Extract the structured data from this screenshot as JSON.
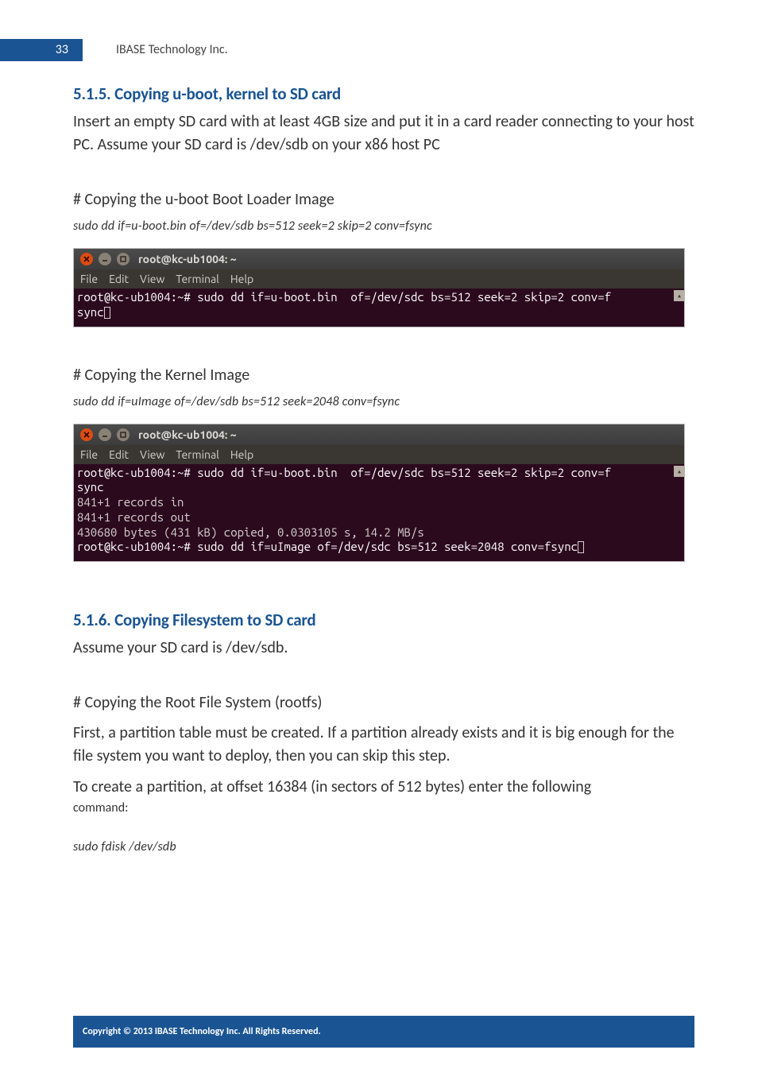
{
  "header": {
    "page_number": "33",
    "company": "IBASE Technology Inc."
  },
  "sec515": {
    "title": "5.1.5. Copying u-boot, kernel to SD card",
    "para": "Insert an empty SD card with at least 4GB size and put it in a card reader connecting to your host PC. Assume your SD card is /dev/sdb on your x86 host PC",
    "sub1": "# Copying the u-boot Boot Loader Image",
    "cmd1": "sudo dd if=u-boot.bin    of=/dev/sdb bs=512 seek=2 skip=2 conv=fsync",
    "sub2": "# Copying the Kernel Image",
    "cmd2": "sudo dd if=uImage of=/dev/sdb bs=512 seek=2048 conv=fsync"
  },
  "term": {
    "title": "root@kc-ub1004: ~",
    "menu": {
      "file": "File",
      "edit": "Edit",
      "view": "View",
      "terminal": "Terminal",
      "help": "Help"
    },
    "t1_line1a": "root@kc-ub1004:~# sudo dd if=u-boot.bin  of=/dev/sdc bs=512 seek=2 skip=2 conv=f",
    "t1_line2": "sync",
    "t2_line1a": "root@kc-ub1004:~# sudo dd if=u-boot.bin  of=/dev/sdc bs=512 seek=2 skip=2 conv=f",
    "t2_line2": "sync",
    "t2_line3": "841+1 records in",
    "t2_line4": "841+1 records out",
    "t2_line5": "430680 bytes (431 kB) copied, 0.0303105 s, 14.2 MB/s",
    "t2_line6": "root@kc-ub1004:~# sudo dd if=uImage of=/dev/sdc bs=512 seek=2048 conv=fsync",
    "scroll_glyph": "▴"
  },
  "sec516": {
    "title": "5.1.6. Copying Filesystem to SD card",
    "para1": "Assume your SD card is /dev/sdb.",
    "sub1": "# Copying the Root File System (rootfs)",
    "para2": "First, a partition table must be created. If a partition already exists and it is big enough for the file system you want to deploy, then you can skip this step.",
    "para3": "To create a partition, at offset 16384 (in sectors of 512 bytes) enter the following",
    "para3b": "command:",
    "cmd1": "sudo fdisk /dev/sdb"
  },
  "footer": "Copyright © 2013 IBASE Technology Inc. All Rights Reserved."
}
